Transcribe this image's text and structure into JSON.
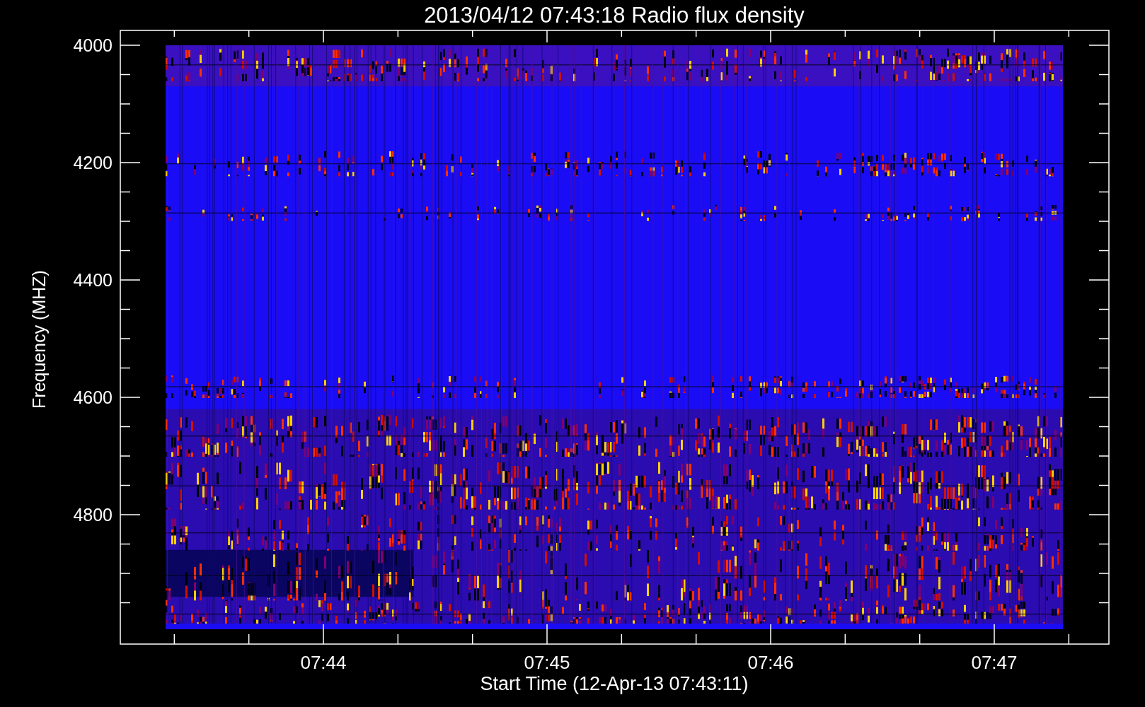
{
  "title": "2013/04/12 07:43:18 Radio flux density",
  "y_axis": {
    "label": "Frequency (MHZ)",
    "ticks": [
      "4000",
      "4200",
      "4400",
      "4600",
      "4800"
    ]
  },
  "x_axis": {
    "label": "Start Time (12-Apr-13 07:43:11)",
    "ticks": [
      "07:44",
      "07:45",
      "07:46",
      "07:47"
    ]
  }
}
